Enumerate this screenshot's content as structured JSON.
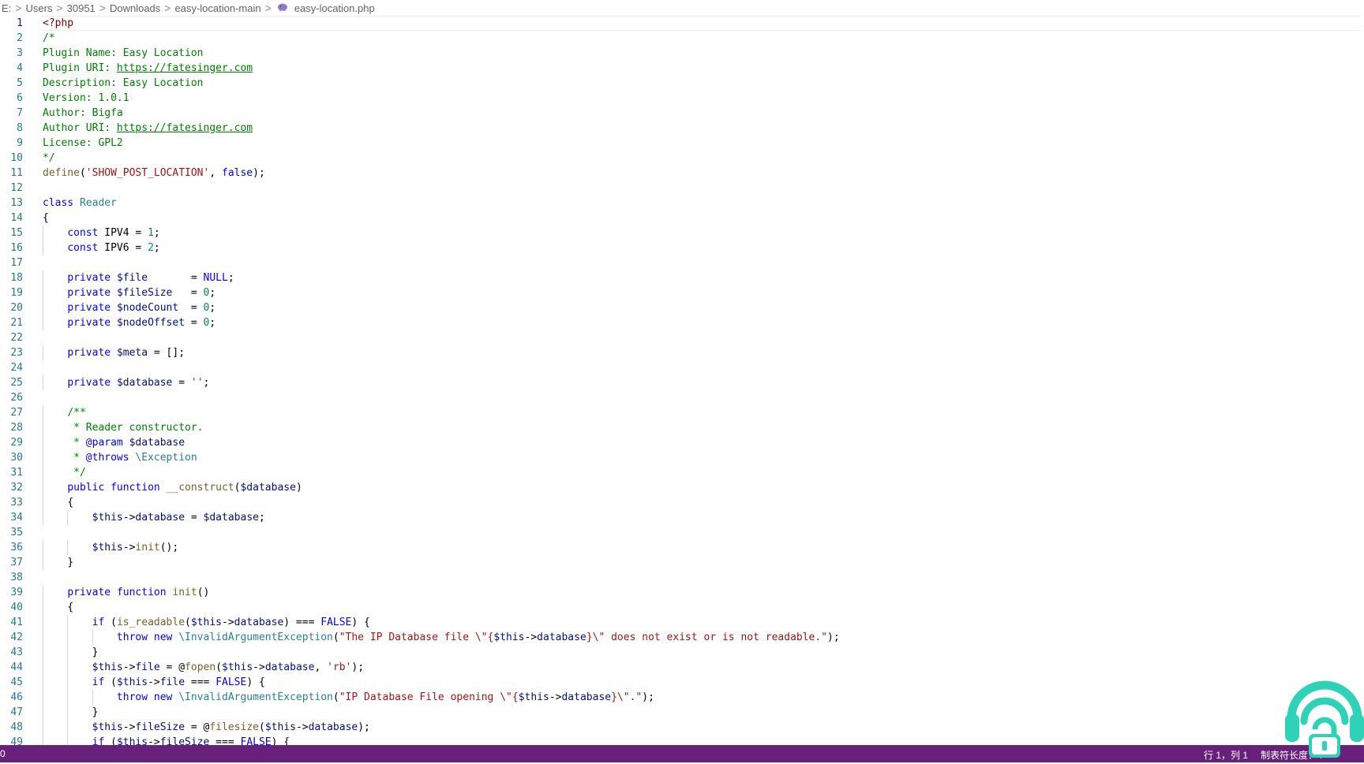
{
  "breadcrumb": {
    "items": [
      "E:",
      "Users",
      "30951",
      "Downloads",
      "easy-location-main",
      "easy-location.php"
    ],
    "separator": ">",
    "file_icon": "php-elephant-icon"
  },
  "editor": {
    "active_line": 1,
    "lines": [
      {
        "n": 1,
        "indent": 0,
        "tokens": [
          [
            "tag",
            "<?php"
          ]
        ]
      },
      {
        "n": 2,
        "indent": 0,
        "tokens": [
          [
            "cm",
            "/*"
          ]
        ]
      },
      {
        "n": 3,
        "indent": 0,
        "tokens": [
          [
            "cm",
            "Plugin Name: Easy Location"
          ]
        ]
      },
      {
        "n": 4,
        "indent": 0,
        "tokens": [
          [
            "cm",
            "Plugin URI: "
          ],
          [
            "link",
            "https://fatesinger.com"
          ]
        ]
      },
      {
        "n": 5,
        "indent": 0,
        "tokens": [
          [
            "cm",
            "Description: Easy Location"
          ]
        ]
      },
      {
        "n": 6,
        "indent": 0,
        "tokens": [
          [
            "cm",
            "Version: 1.0.1"
          ]
        ]
      },
      {
        "n": 7,
        "indent": 0,
        "tokens": [
          [
            "cm",
            "Author: Bigfa"
          ]
        ]
      },
      {
        "n": 8,
        "indent": 0,
        "tokens": [
          [
            "cm",
            "Author URI: "
          ],
          [
            "link",
            "https://fatesinger.com"
          ]
        ]
      },
      {
        "n": 9,
        "indent": 0,
        "tokens": [
          [
            "cm",
            "License: GPL2"
          ]
        ]
      },
      {
        "n": 10,
        "indent": 0,
        "tokens": [
          [
            "cm",
            "*/"
          ]
        ]
      },
      {
        "n": 11,
        "indent": 0,
        "tokens": [
          [
            "fn",
            "define"
          ],
          [
            "plain",
            "("
          ],
          [
            "str",
            "'SHOW_POST_LOCATION'"
          ],
          [
            "plain",
            ", "
          ],
          [
            "kw",
            "false"
          ],
          [
            "plain",
            ");"
          ]
        ]
      },
      {
        "n": 12,
        "indent": 0,
        "tokens": []
      },
      {
        "n": 13,
        "indent": 0,
        "tokens": [
          [
            "kw",
            "class"
          ],
          [
            "plain",
            " "
          ],
          [
            "cls",
            "Reader"
          ]
        ]
      },
      {
        "n": 14,
        "indent": 0,
        "tokens": [
          [
            "plain",
            "{"
          ]
        ]
      },
      {
        "n": 15,
        "indent": 1,
        "tokens": [
          [
            "kw",
            "const"
          ],
          [
            "plain",
            " IPV4 = "
          ],
          [
            "num",
            "1"
          ],
          [
            "plain",
            ";"
          ]
        ]
      },
      {
        "n": 16,
        "indent": 1,
        "tokens": [
          [
            "kw",
            "const"
          ],
          [
            "plain",
            " IPV6 = "
          ],
          [
            "num",
            "2"
          ],
          [
            "plain",
            ";"
          ]
        ]
      },
      {
        "n": 17,
        "indent": 0,
        "tokens": []
      },
      {
        "n": 18,
        "indent": 1,
        "tokens": [
          [
            "kw",
            "private"
          ],
          [
            "plain",
            " "
          ],
          [
            "var",
            "$file"
          ],
          [
            "plain",
            "       = "
          ],
          [
            "kw",
            "NULL"
          ],
          [
            "plain",
            ";"
          ]
        ]
      },
      {
        "n": 19,
        "indent": 1,
        "tokens": [
          [
            "kw",
            "private"
          ],
          [
            "plain",
            " "
          ],
          [
            "var",
            "$fileSize"
          ],
          [
            "plain",
            "   = "
          ],
          [
            "num",
            "0"
          ],
          [
            "plain",
            ";"
          ]
        ]
      },
      {
        "n": 20,
        "indent": 1,
        "tokens": [
          [
            "kw",
            "private"
          ],
          [
            "plain",
            " "
          ],
          [
            "var",
            "$nodeCount"
          ],
          [
            "plain",
            "  = "
          ],
          [
            "num",
            "0"
          ],
          [
            "plain",
            ";"
          ]
        ]
      },
      {
        "n": 21,
        "indent": 1,
        "tokens": [
          [
            "kw",
            "private"
          ],
          [
            "plain",
            " "
          ],
          [
            "var",
            "$nodeOffset"
          ],
          [
            "plain",
            " = "
          ],
          [
            "num",
            "0"
          ],
          [
            "plain",
            ";"
          ]
        ]
      },
      {
        "n": 22,
        "indent": 0,
        "tokens": []
      },
      {
        "n": 23,
        "indent": 1,
        "tokens": [
          [
            "kw",
            "private"
          ],
          [
            "plain",
            " "
          ],
          [
            "var",
            "$meta"
          ],
          [
            "plain",
            " = [];"
          ]
        ]
      },
      {
        "n": 24,
        "indent": 0,
        "tokens": []
      },
      {
        "n": 25,
        "indent": 1,
        "tokens": [
          [
            "kw",
            "private"
          ],
          [
            "plain",
            " "
          ],
          [
            "var",
            "$database"
          ],
          [
            "plain",
            " = "
          ],
          [
            "str",
            "''"
          ],
          [
            "plain",
            ";"
          ]
        ]
      },
      {
        "n": 26,
        "indent": 0,
        "tokens": []
      },
      {
        "n": 27,
        "indent": 1,
        "tokens": [
          [
            "cm",
            "/**"
          ]
        ]
      },
      {
        "n": 28,
        "indent": 1,
        "tokens": [
          [
            "cm",
            " * Reader constructor."
          ]
        ]
      },
      {
        "n": 29,
        "indent": 1,
        "tokens": [
          [
            "cm",
            " * "
          ],
          [
            "kw",
            "@param"
          ],
          [
            "plain",
            " "
          ],
          [
            "var",
            "$database"
          ]
        ]
      },
      {
        "n": 30,
        "indent": 1,
        "tokens": [
          [
            "cm",
            " * "
          ],
          [
            "kw",
            "@throws"
          ],
          [
            "plain",
            " "
          ],
          [
            "cls",
            "\\Exception"
          ]
        ]
      },
      {
        "n": 31,
        "indent": 1,
        "tokens": [
          [
            "cm",
            " */"
          ]
        ]
      },
      {
        "n": 32,
        "indent": 1,
        "tokens": [
          [
            "kw",
            "public"
          ],
          [
            "plain",
            " "
          ],
          [
            "kw",
            "function"
          ],
          [
            "plain",
            " "
          ],
          [
            "fn",
            "__construct"
          ],
          [
            "plain",
            "("
          ],
          [
            "var",
            "$database"
          ],
          [
            "plain",
            ")"
          ]
        ]
      },
      {
        "n": 33,
        "indent": 1,
        "tokens": [
          [
            "plain",
            "{"
          ]
        ]
      },
      {
        "n": 34,
        "indent": 2,
        "tokens": [
          [
            "var",
            "$this"
          ],
          [
            "plain",
            "->"
          ],
          [
            "var",
            "database"
          ],
          [
            "plain",
            " = "
          ],
          [
            "var",
            "$database"
          ],
          [
            "plain",
            ";"
          ]
        ]
      },
      {
        "n": 35,
        "indent": 0,
        "tokens": []
      },
      {
        "n": 36,
        "indent": 2,
        "tokens": [
          [
            "var",
            "$this"
          ],
          [
            "plain",
            "->"
          ],
          [
            "fn",
            "init"
          ],
          [
            "plain",
            "();"
          ]
        ]
      },
      {
        "n": 37,
        "indent": 1,
        "tokens": [
          [
            "plain",
            "}"
          ]
        ]
      },
      {
        "n": 38,
        "indent": 0,
        "tokens": []
      },
      {
        "n": 39,
        "indent": 1,
        "tokens": [
          [
            "kw",
            "private"
          ],
          [
            "plain",
            " "
          ],
          [
            "kw",
            "function"
          ],
          [
            "plain",
            " "
          ],
          [
            "fn",
            "init"
          ],
          [
            "plain",
            "()"
          ]
        ]
      },
      {
        "n": 40,
        "indent": 1,
        "tokens": [
          [
            "plain",
            "{"
          ]
        ]
      },
      {
        "n": 41,
        "indent": 2,
        "tokens": [
          [
            "kw",
            "if"
          ],
          [
            "plain",
            " ("
          ],
          [
            "fn",
            "is_readable"
          ],
          [
            "plain",
            "("
          ],
          [
            "var",
            "$this"
          ],
          [
            "plain",
            "->"
          ],
          [
            "var",
            "database"
          ],
          [
            "plain",
            ") === "
          ],
          [
            "kw",
            "FALSE"
          ],
          [
            "plain",
            ") {"
          ]
        ]
      },
      {
        "n": 42,
        "indent": 3,
        "tokens": [
          [
            "kw",
            "throw"
          ],
          [
            "plain",
            " "
          ],
          [
            "kw",
            "new"
          ],
          [
            "plain",
            " "
          ],
          [
            "cls",
            "\\InvalidArgumentException"
          ],
          [
            "plain",
            "("
          ],
          [
            "str",
            "\"The IP Database file \\\"{"
          ],
          [
            "var",
            "$this"
          ],
          [
            "plain",
            "->"
          ],
          [
            "var",
            "database"
          ],
          [
            "str",
            "}\\\" does not exist or is not readable.\""
          ],
          [
            "plain",
            ");"
          ]
        ]
      },
      {
        "n": 43,
        "indent": 2,
        "tokens": [
          [
            "plain",
            "}"
          ]
        ]
      },
      {
        "n": 44,
        "indent": 2,
        "tokens": [
          [
            "var",
            "$this"
          ],
          [
            "plain",
            "->"
          ],
          [
            "var",
            "file"
          ],
          [
            "plain",
            " = @"
          ],
          [
            "fn",
            "fopen"
          ],
          [
            "plain",
            "("
          ],
          [
            "var",
            "$this"
          ],
          [
            "plain",
            "->"
          ],
          [
            "var",
            "database"
          ],
          [
            "plain",
            ", "
          ],
          [
            "str",
            "'rb'"
          ],
          [
            "plain",
            ");"
          ]
        ]
      },
      {
        "n": 45,
        "indent": 2,
        "tokens": [
          [
            "kw",
            "if"
          ],
          [
            "plain",
            " ("
          ],
          [
            "var",
            "$this"
          ],
          [
            "plain",
            "->"
          ],
          [
            "var",
            "file"
          ],
          [
            "plain",
            " === "
          ],
          [
            "kw",
            "FALSE"
          ],
          [
            "plain",
            ") {"
          ]
        ]
      },
      {
        "n": 46,
        "indent": 3,
        "tokens": [
          [
            "kw",
            "throw"
          ],
          [
            "plain",
            " "
          ],
          [
            "kw",
            "new"
          ],
          [
            "plain",
            " "
          ],
          [
            "cls",
            "\\InvalidArgumentException"
          ],
          [
            "plain",
            "("
          ],
          [
            "str",
            "\"IP Database File opening \\\"{"
          ],
          [
            "var",
            "$this"
          ],
          [
            "plain",
            "->"
          ],
          [
            "var",
            "database"
          ],
          [
            "str",
            "}\\\".\""
          ],
          [
            "plain",
            ");"
          ]
        ]
      },
      {
        "n": 47,
        "indent": 2,
        "tokens": [
          [
            "plain",
            "}"
          ]
        ]
      },
      {
        "n": 48,
        "indent": 2,
        "tokens": [
          [
            "var",
            "$this"
          ],
          [
            "plain",
            "->"
          ],
          [
            "var",
            "fileSize"
          ],
          [
            "plain",
            " = @"
          ],
          [
            "fn",
            "filesize"
          ],
          [
            "plain",
            "("
          ],
          [
            "var",
            "$this"
          ],
          [
            "plain",
            "->"
          ],
          [
            "var",
            "database"
          ],
          [
            "plain",
            ");"
          ]
        ]
      },
      {
        "n": 49,
        "indent": 2,
        "tokens": [
          [
            "kw",
            "if"
          ],
          [
            "plain",
            " ("
          ],
          [
            "var",
            "$this"
          ],
          [
            "plain",
            "->"
          ],
          [
            "var",
            "fileSize"
          ],
          [
            "plain",
            " === "
          ],
          [
            "kw",
            "FALSE"
          ],
          [
            "plain",
            ") {"
          ]
        ]
      }
    ]
  },
  "statusbar": {
    "left_text": "0",
    "cursor_position": "行 1，列 1",
    "indent_mode": "制表符长度：4",
    "background": "#68217a"
  },
  "watermark": {
    "icon": "podcast-lock-logo-icon",
    "color": "#2ed3b7"
  }
}
